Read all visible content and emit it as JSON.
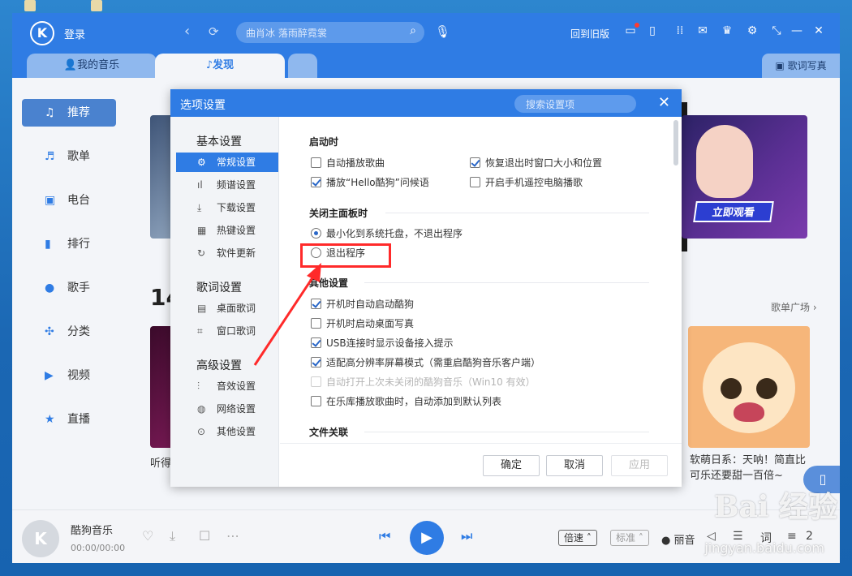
{
  "app": {
    "login": "登录",
    "search_placeholder": "曲肖冰 落雨醉霓裳",
    "old_version": "回到旧版",
    "tabs": [
      "我的音乐",
      "发现"
    ],
    "lyric_poster": "歌词写真"
  },
  "sidebar": {
    "items": [
      {
        "label": "推荐",
        "icon": "music-note-icon"
      },
      {
        "label": "歌单",
        "icon": "playlist-icon"
      },
      {
        "label": "电台",
        "icon": "radio-icon"
      },
      {
        "label": "排行",
        "icon": "chart-icon"
      },
      {
        "label": "歌手",
        "icon": "singer-icon"
      },
      {
        "label": "分类",
        "icon": "category-icon"
      },
      {
        "label": "视频",
        "icon": "video-icon"
      },
      {
        "label": "直播",
        "icon": "live-icon"
      }
    ]
  },
  "content": {
    "banner_button": "立即观看",
    "section_num": "14",
    "playlist_square": "歌单广场 ›",
    "card_left_text": "听得",
    "card_right_text": "软萌日系：天呐！简直比可乐还要甜一百倍~"
  },
  "player": {
    "song": "酷狗音乐",
    "time": "00:00/00:00",
    "speed": "倍速",
    "quality": "标准",
    "mode": "丽音",
    "lyric": "词",
    "count": "2"
  },
  "dialog": {
    "title": "选项设置",
    "search_placeholder": "搜索设置项",
    "nav": {
      "groups": [
        {
          "title": "基本设置",
          "items": [
            {
              "label": "常规设置",
              "icon": "gear-icon"
            },
            {
              "label": "频谱设置",
              "icon": "spectrum-icon"
            },
            {
              "label": "下载设置",
              "icon": "download-icon"
            },
            {
              "label": "热键设置",
              "icon": "keyboard-icon"
            },
            {
              "label": "软件更新",
              "icon": "refresh-icon"
            }
          ]
        },
        {
          "title": "歌词设置",
          "items": [
            {
              "label": "桌面歌词",
              "icon": "desktop-lyric-icon"
            },
            {
              "label": "窗口歌词",
              "icon": "window-lyric-icon"
            }
          ]
        },
        {
          "title": "高级设置",
          "items": [
            {
              "label": "音效设置",
              "icon": "equalizer-icon"
            },
            {
              "label": "网络设置",
              "icon": "globe-icon"
            },
            {
              "label": "其他设置",
              "icon": "more-icon"
            }
          ]
        }
      ]
    },
    "sections": {
      "startup": {
        "title": "启动时",
        "options": [
          {
            "label": "自动播放歌曲",
            "checked": false
          },
          {
            "label": "恢复退出时窗口大小和位置",
            "checked": true
          },
          {
            "label": "播放“Hello酷狗”问候语",
            "checked": true
          },
          {
            "label": "开启手机遥控电脑播歌",
            "checked": false
          }
        ]
      },
      "close": {
        "title": "关闭主面板时",
        "options": [
          {
            "label": "最小化到系统托盘，不退出程序",
            "selected": true
          },
          {
            "label": "退出程序",
            "selected": false
          }
        ]
      },
      "other": {
        "title": "其他设置",
        "options": [
          {
            "label": "开机时自动启动酷狗",
            "checked": true
          },
          {
            "label": "开机时启动桌面写真",
            "checked": false
          },
          {
            "label": "USB连接时显示设备接入提示",
            "checked": true
          },
          {
            "label": "适配高分辨率屏幕模式（需重启酷狗音乐客户端）",
            "checked": true
          },
          {
            "label": "自动打开上次未关闭的酷狗音乐（Win10 有效）",
            "checked": false,
            "disabled": true
          },
          {
            "label": "在乐库播放歌曲时，自动添加到默认列表",
            "checked": false
          }
        ]
      },
      "file": {
        "title": "文件关联"
      }
    },
    "buttons": {
      "ok": "确定",
      "cancel": "取消",
      "apply": "应用"
    }
  },
  "watermark": {
    "brand": "Bai 经验",
    "url": "jingyan.baidu.com"
  },
  "colors": {
    "accent": "#2f7ce4",
    "highlight": "#ff2a2a"
  }
}
